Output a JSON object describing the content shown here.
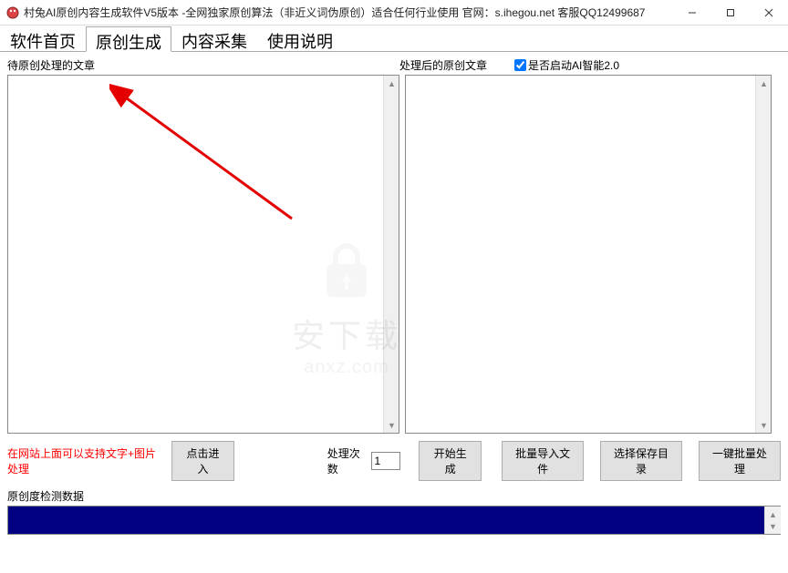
{
  "titlebar": {
    "text": "村兔AI原创内容生成软件V5版本 -全网独家原创算法（非近义词伪原创）适合任何行业使用 官网：s.ihegou.net 客服QQ12499687"
  },
  "tabs": {
    "items": [
      {
        "label": "软件首页",
        "active": false
      },
      {
        "label": "原创生成",
        "active": true
      },
      {
        "label": "内容采集",
        "active": false
      },
      {
        "label": "使用说明",
        "active": false
      }
    ]
  },
  "panels": {
    "left_label": "待原创处理的文章",
    "right_label": "处理后的原创文章",
    "checkbox_label": "是否启动AI智能2.0",
    "checkbox_checked": true
  },
  "bottom": {
    "hint_text": "在网站上面可以支持文字+图片处理",
    "enter_btn": "点击进入",
    "count_label": "处理次数",
    "count_value": "1",
    "start_btn": "开始生成",
    "import_btn": "批量导入文件",
    "save_btn": "选择保存目录",
    "batch_btn": "一键批量处理"
  },
  "detect": {
    "label": "原创度检测数据"
  },
  "watermark": {
    "text": "安下载",
    "url": "anxz.com"
  }
}
